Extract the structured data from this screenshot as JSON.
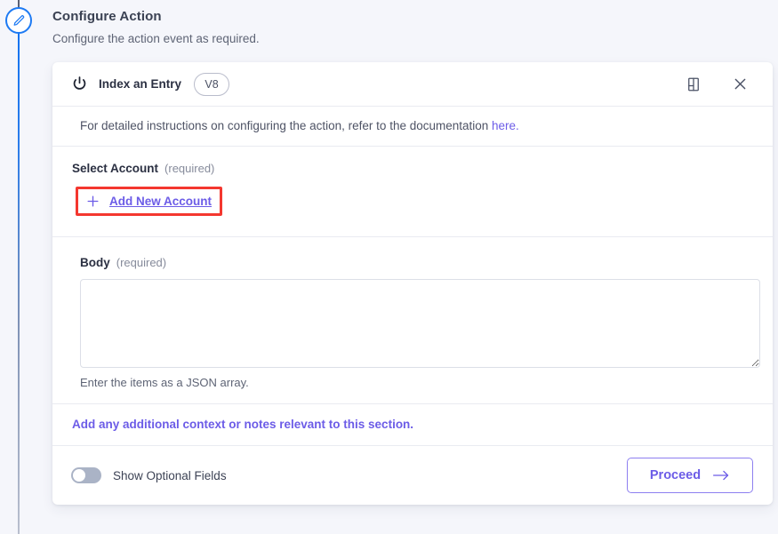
{
  "heading": {
    "title": "Configure Action",
    "subtitle": "Configure the action event as required."
  },
  "rail": {
    "node_icon": "pencil-icon"
  },
  "card": {
    "icon": "power-icon",
    "title": "Index an Entry",
    "version_badge": "V8",
    "doc_icon": "book-icon",
    "close_icon": "close-icon",
    "instruction": {
      "text": "For detailed instructions on configuring the action, refer to the documentation ",
      "link_label": "here."
    },
    "select_account": {
      "label": "Select Account",
      "required_note": "(required)",
      "add_link_label": "Add New Account",
      "plus_icon": "plus-icon",
      "highlight_color": "#f4372f"
    },
    "body": {
      "label": "Body",
      "required_note": "(required)",
      "value": "",
      "placeholder": "",
      "helper_text": "Enter the items as a JSON array."
    },
    "context_link_label": "Add any additional context or notes relevant to this section.",
    "footer": {
      "toggle_label": "Show Optional Fields",
      "toggle_state": "off",
      "proceed_label": "Proceed",
      "proceed_arrow_icon": "arrow-right-icon"
    }
  },
  "colors": {
    "accent_purple": "#6c5ce7",
    "rail_blue": "#1d7af3",
    "highlight_red": "#f4372f",
    "page_background": "#f5f6fb"
  }
}
